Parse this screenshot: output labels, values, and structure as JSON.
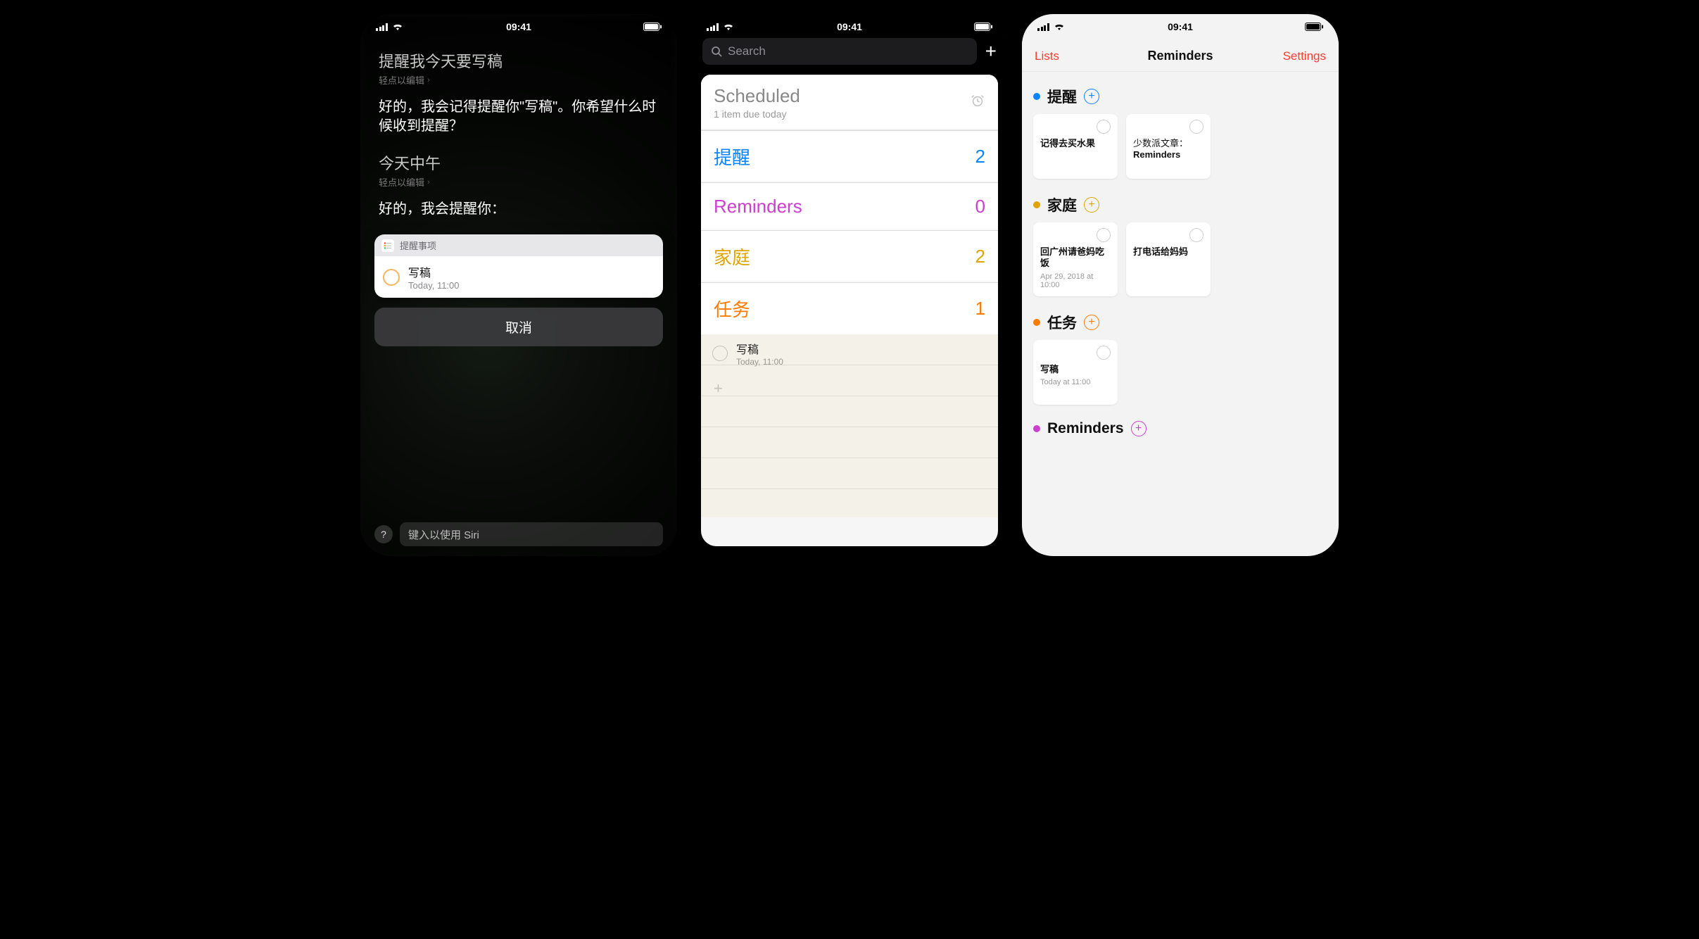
{
  "status_time": "09:41",
  "phone1": {
    "request1": "提醒我今天要写稿",
    "tap_edit": "轻点以编辑",
    "response1": "好的，我会记得提醒你\"写稿\"。你希望什么时候收到提醒？",
    "request2": "今天中午",
    "response2": "好的，我会提醒你：",
    "card_app": "提醒事项",
    "card_title": "写稿",
    "card_sub": "Today, 11:00",
    "cancel": "取消",
    "siri_placeholder": "键入以使用 Siri",
    "help": "?"
  },
  "phone2": {
    "search_placeholder": "Search",
    "scheduled_title": "Scheduled",
    "scheduled_sub": "1 item due today",
    "lists": [
      {
        "name": "提醒",
        "count": "2",
        "cls": "c-blue"
      },
      {
        "name": "Reminders",
        "count": "0",
        "cls": "c-pink"
      },
      {
        "name": "家庭",
        "count": "2",
        "cls": "c-gold"
      },
      {
        "name": "任务",
        "count": "1",
        "cls": "c-orange"
      }
    ],
    "task_title": "写稿",
    "task_sub": "Today, 11:00"
  },
  "phone3": {
    "nav_left": "Lists",
    "nav_title": "Reminders",
    "nav_right": "Settings",
    "sections": [
      {
        "name": "提醒",
        "dot": "d-blue",
        "pc": "pc-blue",
        "cards": [
          {
            "t": "记得去买水果"
          },
          {
            "t": "少数派文章：Reminders",
            "bold_last": true
          }
        ]
      },
      {
        "name": "家庭",
        "dot": "d-gold",
        "pc": "pc-gold",
        "cards": [
          {
            "t": "回广州请爸妈吃饭",
            "d": "Apr 29, 2018 at 10:00"
          },
          {
            "t": "打电话给妈妈"
          }
        ]
      },
      {
        "name": "任务",
        "dot": "d-orange",
        "pc": "pc-orange",
        "cards": [
          {
            "t": "写稿",
            "d": "Today at 11:00"
          }
        ]
      },
      {
        "name": "Reminders",
        "dot": "d-pink",
        "pc": "pc-pink",
        "cards": []
      }
    ]
  }
}
